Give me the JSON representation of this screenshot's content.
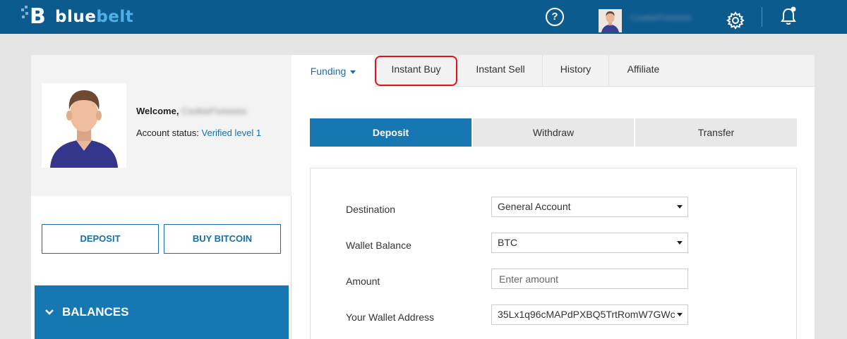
{
  "brand": {
    "name_part1": "blue",
    "name_part2": "belt",
    "logo_letter": "B"
  },
  "topbar": {
    "help_icon": "question-circle-icon",
    "help_glyph": "?",
    "username": "CookieFiveeees",
    "settings_icon": "gear-icon",
    "notifications_icon": "bell-icon"
  },
  "profile": {
    "welcome_label": "Welcome,",
    "username": "CookieFiveeees",
    "status_label": "Account status:",
    "status_value": "Verified level 1"
  },
  "actions": {
    "deposit_label": "DEPOSIT",
    "buy_bitcoin_label": "BUY BITCOIN"
  },
  "balances": {
    "label": "BALANCES"
  },
  "tabs": {
    "funding": "Funding",
    "instant_buy": "Instant Buy",
    "instant_sell": "Instant Sell",
    "history": "History",
    "affiliate": "Affiliate"
  },
  "subtabs": {
    "deposit": "Deposit",
    "withdraw": "Withdraw",
    "transfer": "Transfer"
  },
  "form": {
    "destination_label": "Destination",
    "destination_value": "General Account",
    "wallet_balance_label": "Wallet Balance",
    "wallet_balance_value": "BTC",
    "amount_label": "Amount",
    "amount_placeholder": "Enter amount",
    "wallet_address_label": "Your Wallet Address",
    "wallet_address_value": "35Lx1q96cMAPdPXBQ5TrtRomW7GWc"
  },
  "colors": {
    "topbar": "#0c5b8f",
    "accent": "#1677b3",
    "link": "#1a6fa8",
    "highlight": "#e0121b"
  }
}
